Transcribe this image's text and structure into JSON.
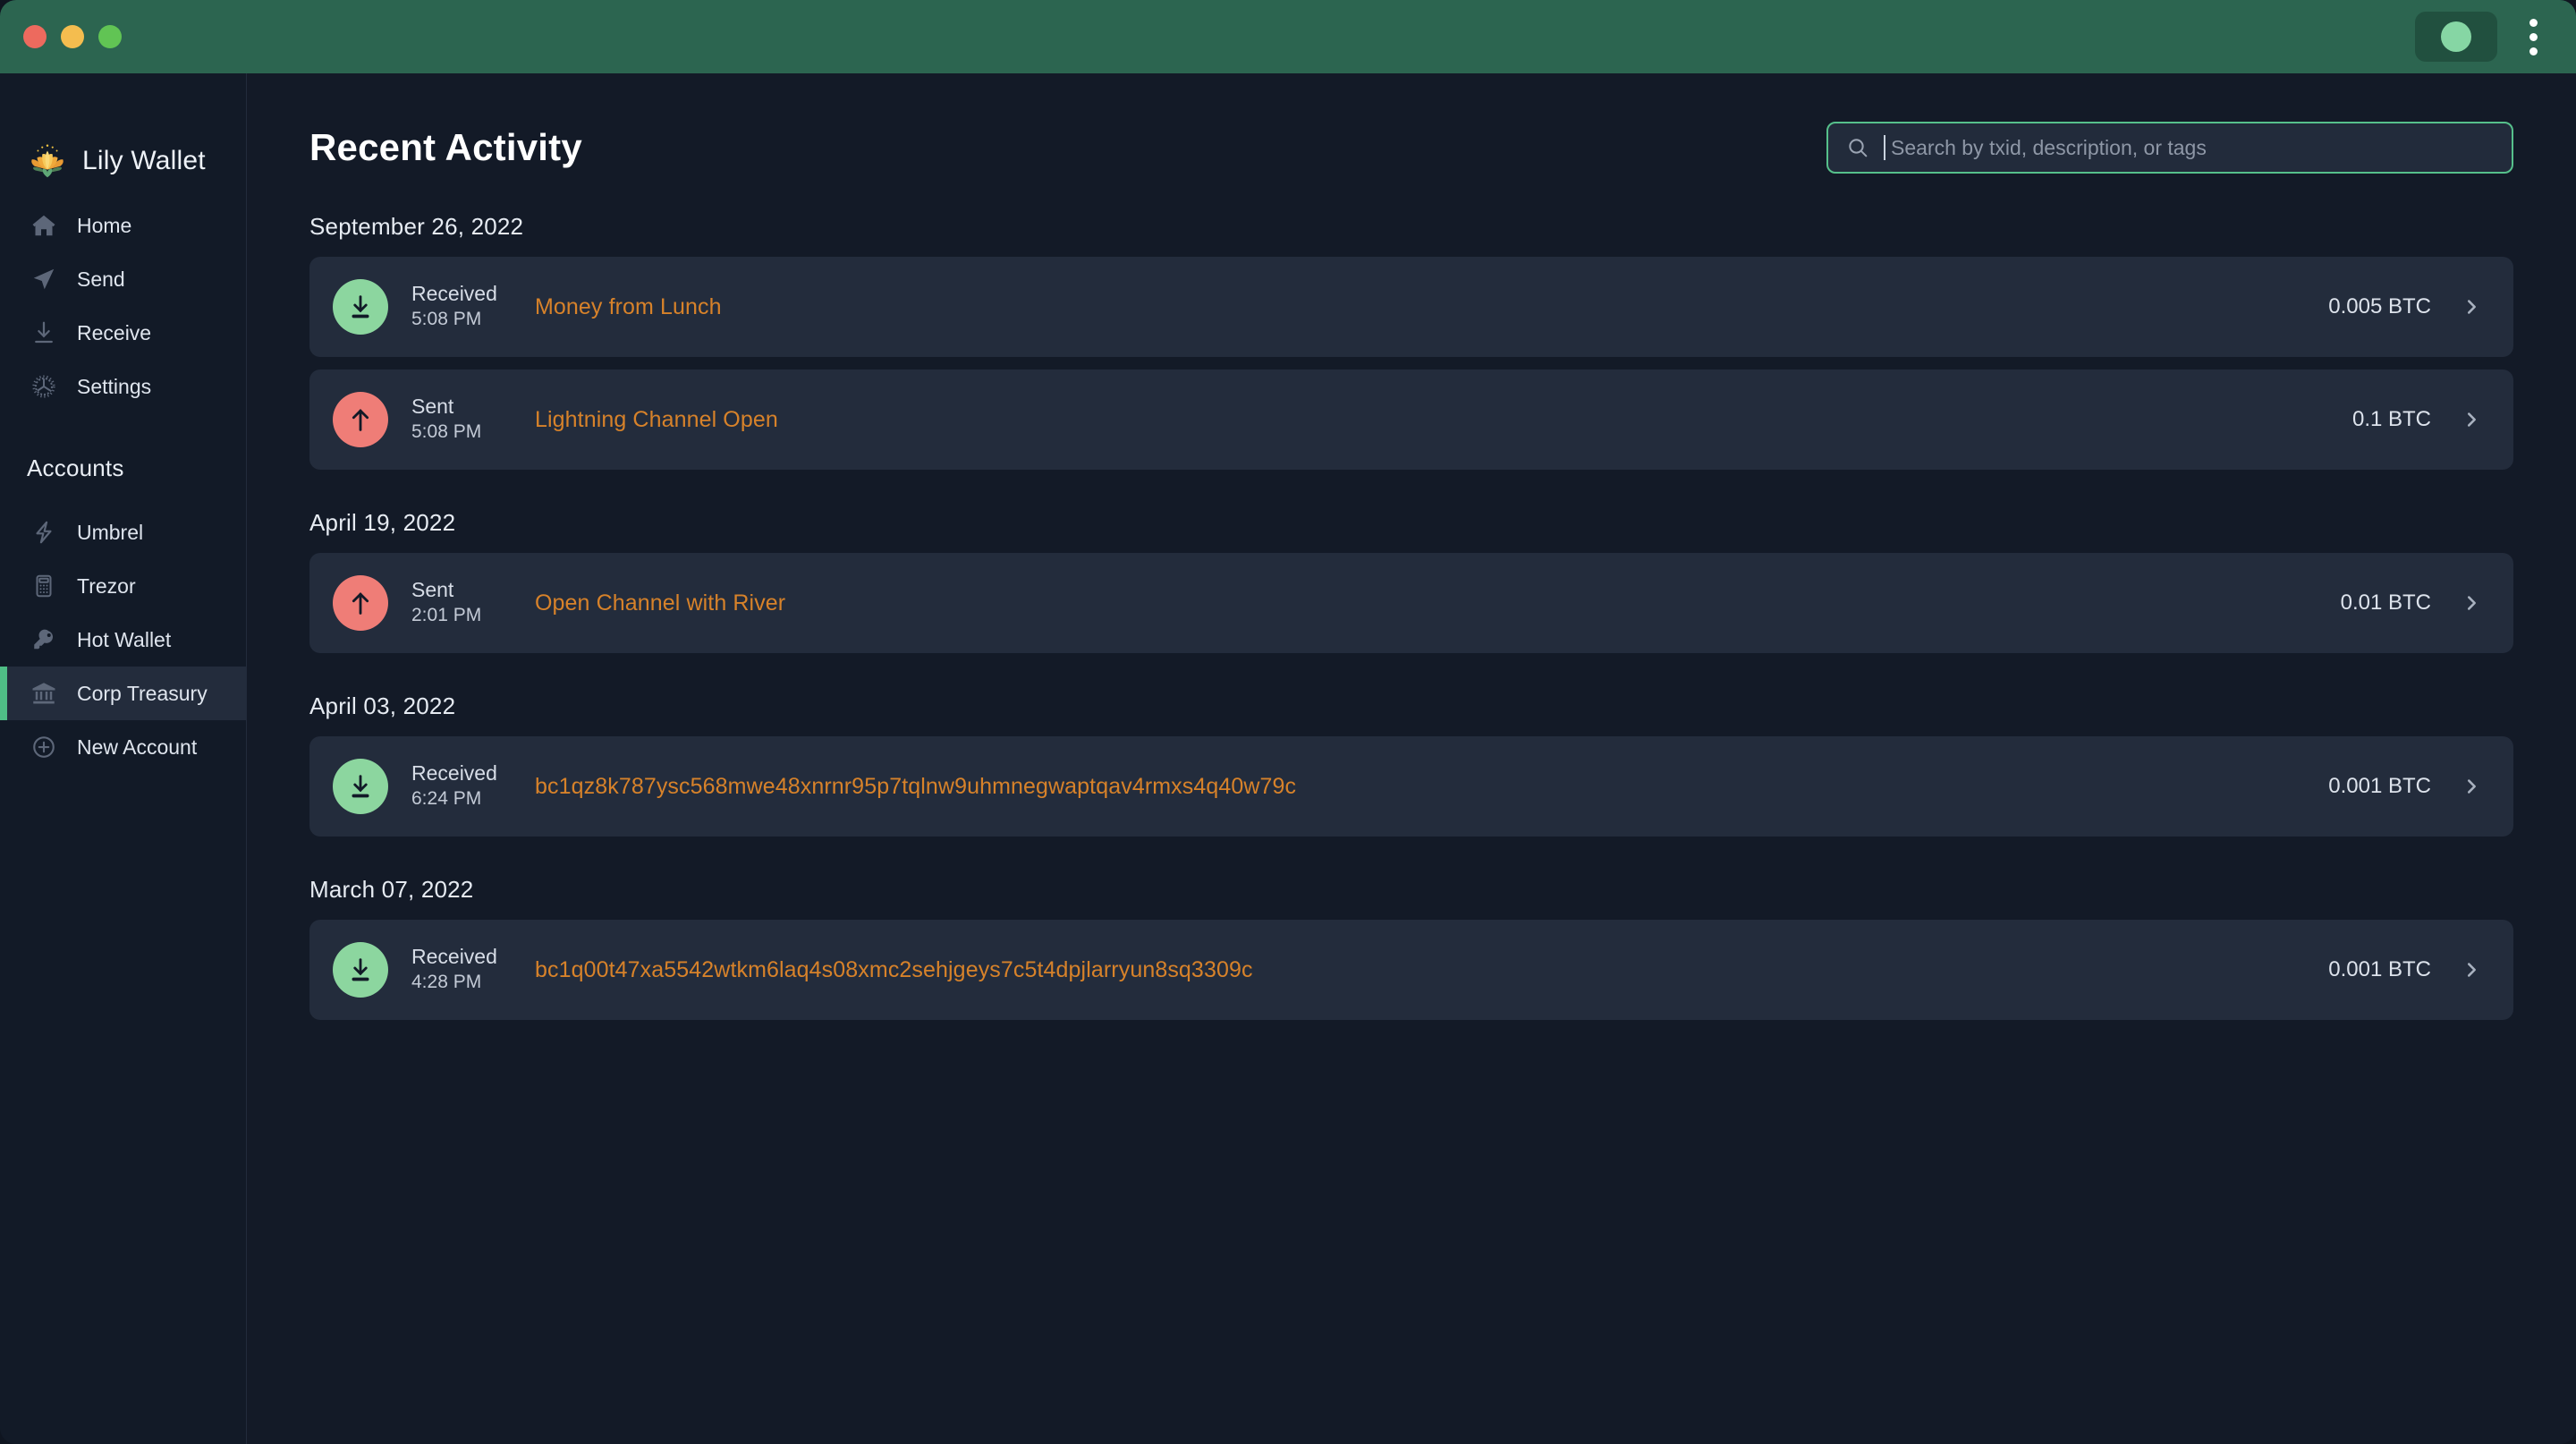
{
  "titlebar": {
    "traffic_lights": [
      "close",
      "minimize",
      "maximize"
    ],
    "status_indicator": "connected",
    "menu_label": "More options",
    "colors": {
      "bar": "#2c6550",
      "pill": "#21503f",
      "status_dot": "#86d6a4"
    }
  },
  "sidebar": {
    "brand": {
      "name": "Lily Wallet",
      "logo": "lotus-icon"
    },
    "nav": [
      {
        "label": "Home",
        "icon": "home-icon",
        "active": false
      },
      {
        "label": "Send",
        "icon": "send-icon",
        "active": false
      },
      {
        "label": "Receive",
        "icon": "receive-icon",
        "active": false
      },
      {
        "label": "Settings",
        "icon": "gear-icon",
        "active": false
      }
    ],
    "accounts_title": "Accounts",
    "accounts": [
      {
        "label": "Umbrel",
        "icon": "lightning-icon",
        "active": false
      },
      {
        "label": "Trezor",
        "icon": "hardware-device-icon",
        "active": false
      },
      {
        "label": "Hot Wallet",
        "icon": "key-icon",
        "active": false
      },
      {
        "label": "Corp Treasury",
        "icon": "bank-icon",
        "active": true
      },
      {
        "label": "New Account",
        "icon": "plus-circle-icon",
        "active": false
      }
    ],
    "active_accent": "#4fbe86"
  },
  "main": {
    "page_title": "Recent Activity",
    "search": {
      "placeholder": "Search by txid, description, or tags",
      "value": "",
      "icon": "search-icon",
      "focused": true,
      "focus_color": "#56c08b"
    },
    "groups": [
      {
        "date": "September 26, 2022",
        "transactions": [
          {
            "type": "Received",
            "time": "5:08 PM",
            "description": "Money from Lunch",
            "amount": "0.005 BTC",
            "direction": "received",
            "icon": "arrow-down-to-line-icon"
          },
          {
            "type": "Sent",
            "time": "5:08 PM",
            "description": "Lightning Channel Open",
            "amount": "0.1 BTC",
            "direction": "sent",
            "icon": "arrow-up-icon"
          }
        ]
      },
      {
        "date": "April 19, 2022",
        "transactions": [
          {
            "type": "Sent",
            "time": "2:01 PM",
            "description": "Open Channel with River",
            "amount": "0.01 BTC",
            "direction": "sent",
            "icon": "arrow-up-icon"
          }
        ]
      },
      {
        "date": "April 03, 2022",
        "transactions": [
          {
            "type": "Received",
            "time": "6:24 PM",
            "description": "bc1qz8k787ysc568mwe48xnrnr95p7tqlnw9uhmnegwaptqav4rmxs4q40w79c",
            "amount": "0.001 BTC",
            "direction": "received",
            "icon": "arrow-down-to-line-icon"
          }
        ]
      },
      {
        "date": "March 07, 2022",
        "transactions": [
          {
            "type": "Received",
            "time": "4:28 PM",
            "description": "bc1q00t47xa5542wtkm6laq4s08xmc2sehjgeys7c5t4dpjlarryun8sq3309c",
            "amount": "0.001 BTC",
            "direction": "received",
            "icon": "arrow-down-to-line-icon"
          }
        ]
      }
    ],
    "colors": {
      "received_badge": "#8cd69f",
      "sent_badge": "#ef7d77",
      "description": "#d7822a",
      "row_bg": "#232c3c",
      "page_bg": "#131a27"
    }
  }
}
